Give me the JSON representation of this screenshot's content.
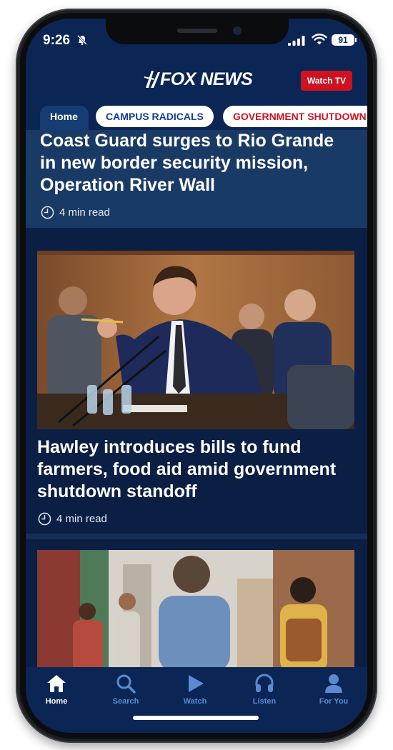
{
  "status_bar": {
    "time": "9:26",
    "battery": "91"
  },
  "header": {
    "brand": "FOX NEWS",
    "watch_tv_label": "Watch TV"
  },
  "tabs": [
    {
      "label": "Home",
      "active": true
    },
    {
      "label": "CAMPUS RADICALS",
      "color": "#153d9c"
    },
    {
      "label": "GOVERNMENT SHUTDOWN",
      "color": "#cf1221"
    }
  ],
  "stories": [
    {
      "headline": "Coast Guard surges to Rio Grande in new border security mission, Operation River Wall",
      "read_time": "4 min read"
    },
    {
      "headline": "Hawley introduces bills to fund farmers, food aid amid government shutdown standoff",
      "read_time": "4 min read"
    }
  ],
  "bottom_nav": [
    {
      "label": "Home",
      "icon": "home-icon",
      "active": true
    },
    {
      "label": "Search",
      "icon": "search-icon"
    },
    {
      "label": "Watch",
      "icon": "play-icon"
    },
    {
      "label": "Listen",
      "icon": "headphones-icon"
    },
    {
      "label": "For You",
      "icon": "person-icon"
    }
  ],
  "colors": {
    "brand_blue": "#0b2555",
    "accent_red": "#cf1221",
    "nav_inactive": "#5b8ad0"
  }
}
